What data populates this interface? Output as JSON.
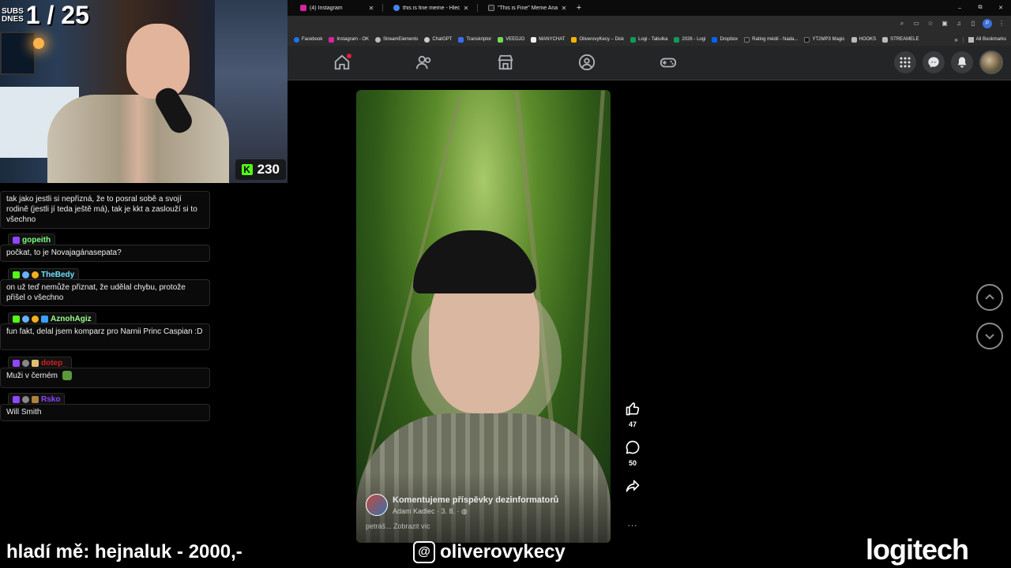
{
  "browser": {
    "tabs": [
      {
        "title": "(4) Instagram",
        "fav_color": "#d6249f"
      },
      {
        "title": "this is fine meme - Hledat Goo",
        "fav_color": "#4285f4"
      },
      {
        "title": "\"This is Fine\" Meme Analysis |",
        "fav_color": "#222222"
      }
    ],
    "new_tab": "+",
    "window_controls": [
      "–",
      "⧉",
      "✕"
    ],
    "profile_initial": "P",
    "bookmarks": [
      {
        "label": "Facebook",
        "color": "#1877f2"
      },
      {
        "label": "Instagram - OK",
        "color": "#d6249f"
      },
      {
        "label": "StreamElements",
        "color": "#bbbbbb"
      },
      {
        "label": "ChatGPT",
        "color": "#cccccc"
      },
      {
        "label": "Transkriptor",
        "color": "#3a6df0"
      },
      {
        "label": "VEEDJO",
        "color": "#6fdc52"
      },
      {
        "label": "MANYCHAT",
        "color": "#eeeeee"
      },
      {
        "label": "OliverovyKecy – Disk",
        "color": "#f4b400"
      },
      {
        "label": "Logi - Tabulka",
        "color": "#0f9d58"
      },
      {
        "label": "2026 - Logi",
        "color": "#0f9d58"
      },
      {
        "label": "Dropbox",
        "color": "#0061ff"
      },
      {
        "label": "Rating médií - Nada...",
        "color": "#222222"
      },
      {
        "label": "YT2MP3 Magic",
        "color": "#111111"
      },
      {
        "label": "HOOKS",
        "color": "#bbbbbb"
      },
      {
        "label": "STREAMELE",
        "color": "#bbbbbb"
      }
    ],
    "bookmarks_more": "»",
    "all_bookmarks": "All Bookmarks"
  },
  "stream": {
    "subs_label_1": "SUBS",
    "subs_label_2": "DNES",
    "subs_count": "1 / 25",
    "kick_viewers": "230",
    "donation": "hladí mě: hejnaluk - 2000,-",
    "handle": "oliverovykecy",
    "sponsor": "logitech"
  },
  "chat": {
    "messages": [
      {
        "text": "tak jako jestli si nepřizná, že to posral sobě a svojí rodině (jestli jí teda ještě má), tak je kkt a zaslouží si to všechno"
      },
      {
        "user": "gopeith",
        "user_color": "#7fff7f",
        "text": "počkat, to je Novajagánasepata?"
      },
      {
        "user": "TheBedy",
        "user_color": "#6ae0ff",
        "text": "on už teď nemůže přiznat, že udělal chybu, protože přišel o všechno"
      },
      {
        "user": "AznohAgiz",
        "user_color": "#9cff8f",
        "text": "fun fakt, delal jsem komparz pro Narnii Princ Caspian :D"
      },
      {
        "user": "dotep_",
        "user_color": "#d42020",
        "text": "Muži v černém"
      },
      {
        "user": "Rsko",
        "user_color": "#8b45ff",
        "text": "Will Smith"
      }
    ]
  },
  "video": {
    "group_title": "Komentujeme příspěvky dezinformatorů",
    "author": "Adam Kadlec",
    "date": "3. 8.",
    "comment_preview": "petráš... Zobrazit víc",
    "likes": "47",
    "comments": "50",
    "more": "..."
  }
}
